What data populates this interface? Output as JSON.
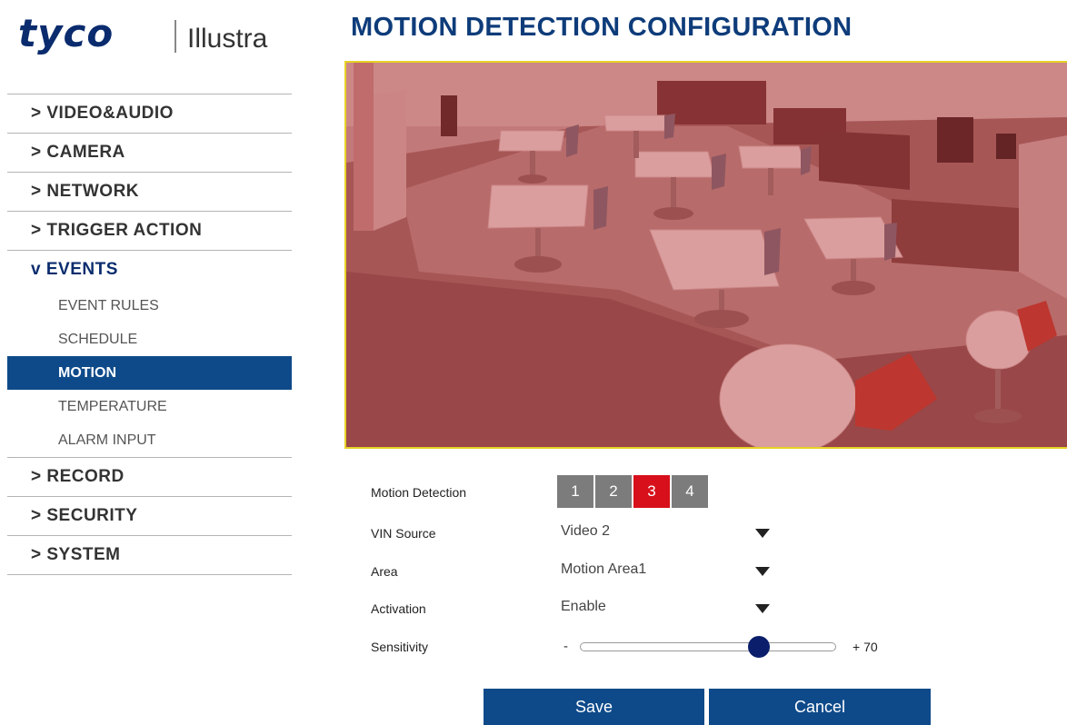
{
  "brand": {
    "logo_main": "tyco",
    "logo_sub": "Illustra"
  },
  "page_title": "MOTION DETECTION CONFIGURATION",
  "nav": {
    "video_audio": "> VIDEO&AUDIO",
    "camera": "> CAMERA",
    "network": "> NETWORK",
    "trigger_action": "> TRIGGER ACTION",
    "events": "v EVENTS",
    "event_rules": "EVENT RULES",
    "schedule": "SCHEDULE",
    "motion": "MOTION",
    "temperature": "TEMPERATURE",
    "alarm_input": "ALARM INPUT",
    "record": "> RECORD",
    "security": "> SECURITY",
    "system": "> SYSTEM"
  },
  "form": {
    "motion_detection_label": "Motion Detection",
    "motion_tabs": [
      "1",
      "2",
      "3",
      "4"
    ],
    "selected_tab": "3",
    "vin_source_label": "VIN Source",
    "vin_source_value": "Video 2",
    "area_label": "Area",
    "area_value": "Motion Area1",
    "activation_label": "Activation",
    "activation_value": "Enable",
    "sensitivity_label": "Sensitivity",
    "sensitivity_min": "-",
    "sensitivity_max": "+",
    "sensitivity_value": "70"
  },
  "buttons": {
    "save": "Save",
    "cancel": "Cancel"
  },
  "colors": {
    "brand_blue": "#0e4a8a",
    "title_blue": "#0e3c7a",
    "selected_tab": "#d7101b",
    "unselected_tab": "#7c7c7c",
    "motion_overlay": "#b43232",
    "frame_border": "#e6d227"
  },
  "icons": {
    "caret": "caret-down-icon",
    "slider_knob": "slider-knob-icon"
  }
}
